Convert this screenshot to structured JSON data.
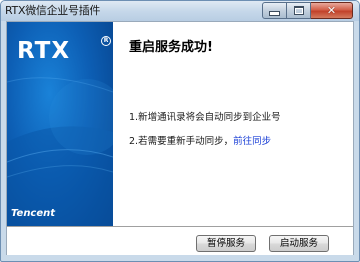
{
  "window": {
    "title": "RTX微信企业号插件",
    "buttons": {
      "minimize": "minimize-icon",
      "maximize": "maximize-icon",
      "close": "close-icon"
    }
  },
  "banner": {
    "logo": "RTX",
    "registered": "R",
    "brand": "Tencent"
  },
  "message": {
    "heading": "重启服务成功!",
    "line1": "1.新增通讯录将会自动同步到企业号",
    "line2_text": "2.若需要重新手动同步，",
    "line2_link": "前往同步"
  },
  "footer": {
    "pause_label": "暂停服务",
    "start_label": "启动服务"
  },
  "colors": {
    "banner_blue": "#0d5fb5",
    "link_blue": "#1a3fd6",
    "close_red": "#c2422a"
  }
}
